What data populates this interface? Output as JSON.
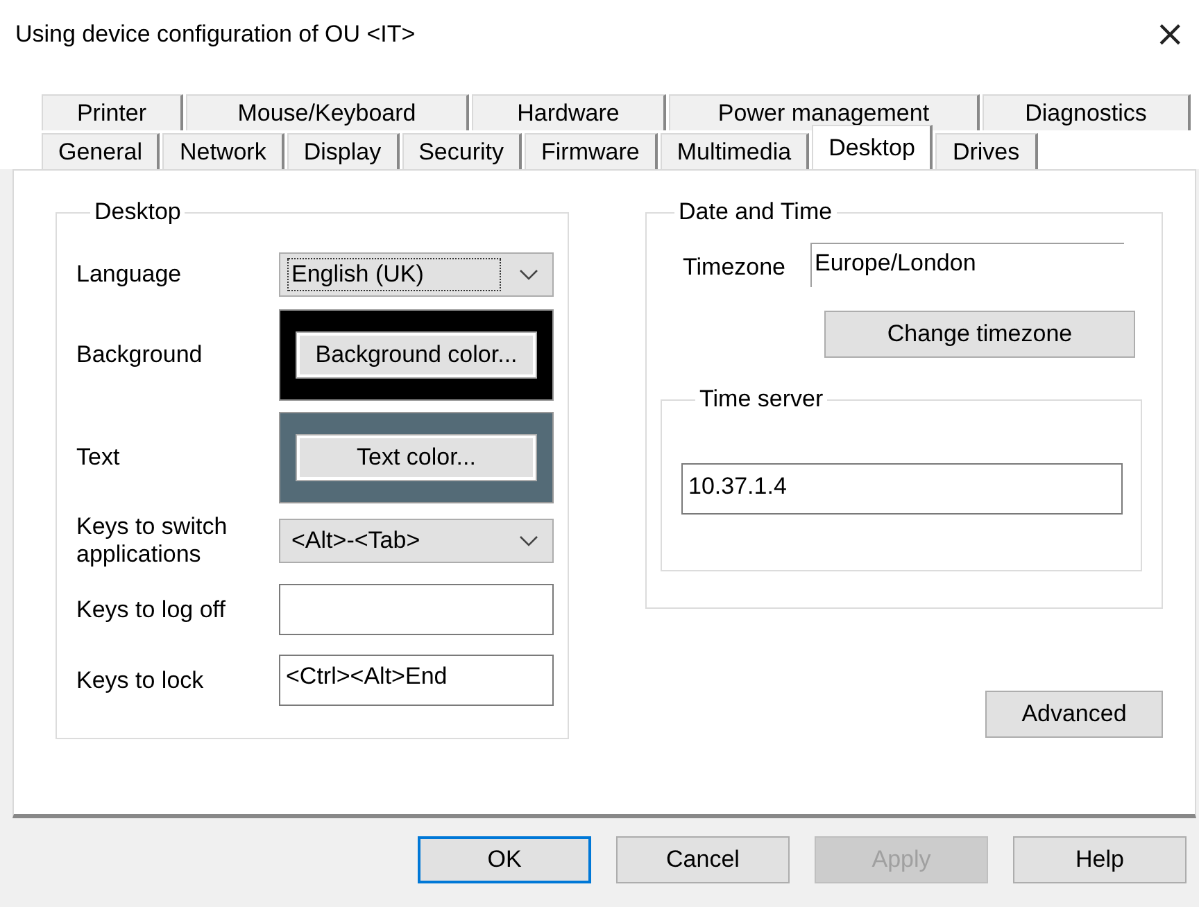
{
  "window": {
    "title": "Using device configuration of OU <IT>",
    "close": "×"
  },
  "tabs": [
    [
      {
        "label": "Printer",
        "selected": false
      },
      {
        "label": "Mouse/Keyboard",
        "selected": false
      },
      {
        "label": "Hardware",
        "selected": false
      },
      {
        "label": "Power management",
        "selected": false
      },
      {
        "label": "Diagnostics",
        "selected": false
      }
    ],
    [
      {
        "label": "General",
        "selected": false
      },
      {
        "label": "Network",
        "selected": false
      },
      {
        "label": "Display",
        "selected": false
      },
      {
        "label": "Security",
        "selected": false
      },
      {
        "label": "Firmware",
        "selected": false
      },
      {
        "label": "Multimedia",
        "selected": false
      },
      {
        "label": "Desktop",
        "selected": true
      },
      {
        "label": "Drives",
        "selected": false
      }
    ]
  ],
  "desktop": {
    "title": "Desktop",
    "rows": [
      {
        "kind": "dropdown",
        "label": "Language",
        "value": "English (UK)",
        "focused": true
      },
      {
        "kind": "color",
        "label": "Background",
        "button": "Background color...",
        "color": "#000000"
      },
      {
        "kind": "color",
        "label": "Text",
        "button": "Text color...",
        "color": "#546b77"
      },
      {
        "kind": "dropdown",
        "label": "Keys to switch applications",
        "value": "<Alt>-<Tab>",
        "focused": false
      },
      {
        "kind": "input",
        "label": "Keys to log off"
      },
      {
        "kind": "input",
        "label": "Keys to lock",
        "value": "<Ctrl><Alt>End"
      }
    ]
  },
  "date_time": {
    "title": "Date and Time",
    "timezone_label": "Timezone",
    "timezone": "Europe/London",
    "change_button": "Change timezone",
    "time_server": {
      "title": "Time server",
      "value": "10.37.1.4"
    }
  },
  "advanced_button": "Advanced",
  "buttons": [
    {
      "label": "OK",
      "default": true,
      "disabled": false
    },
    {
      "label": "Cancel",
      "default": false,
      "disabled": false
    },
    {
      "label": "Apply",
      "default": false,
      "disabled": true
    },
    {
      "label": "Help",
      "default": false,
      "disabled": false
    }
  ]
}
